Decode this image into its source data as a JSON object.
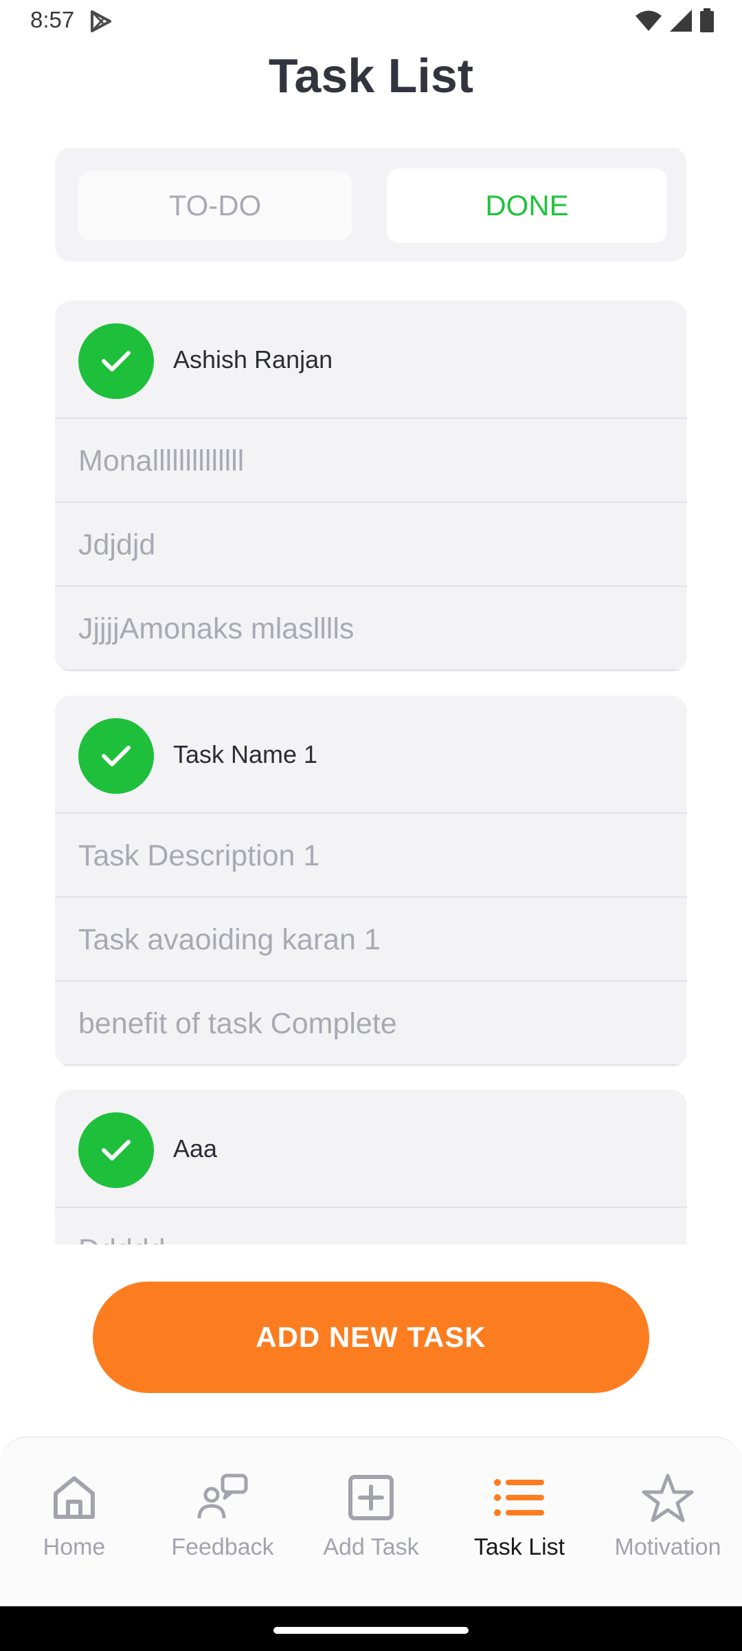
{
  "status_bar": {
    "time": "8:57"
  },
  "header": {
    "title": "Task List"
  },
  "tabs": {
    "todo_label": "TO-DO",
    "done_label": "DONE"
  },
  "tasks": [
    {
      "name": "Ashish Ranjan",
      "description": "Monallllllllllllll",
      "avoiding": "Jdjdjd",
      "benefit": "JjjjjAmonaks mlaslllls"
    },
    {
      "name": "Task Name 1",
      "description": "Task Description 1",
      "avoiding": "Task avaoiding karan 1",
      "benefit": "benefit of task Complete"
    },
    {
      "name": "Aaa",
      "description": "Ddddd",
      "avoiding": "",
      "benefit": ""
    }
  ],
  "actions": {
    "add_task_label": "ADD NEW TASK"
  },
  "nav": {
    "items": [
      {
        "label": "Home",
        "icon": "home-icon"
      },
      {
        "label": "Feedback",
        "icon": "feedback-icon"
      },
      {
        "label": "Add Task",
        "icon": "add-box-icon"
      },
      {
        "label": "Task List",
        "icon": "list-icon"
      },
      {
        "label": "Motivation",
        "icon": "star-icon"
      }
    ],
    "active": "Task List"
  },
  "colors": {
    "accent": "#fc7d20",
    "done_green": "#22c23d",
    "check_green": "#1ec03b"
  }
}
